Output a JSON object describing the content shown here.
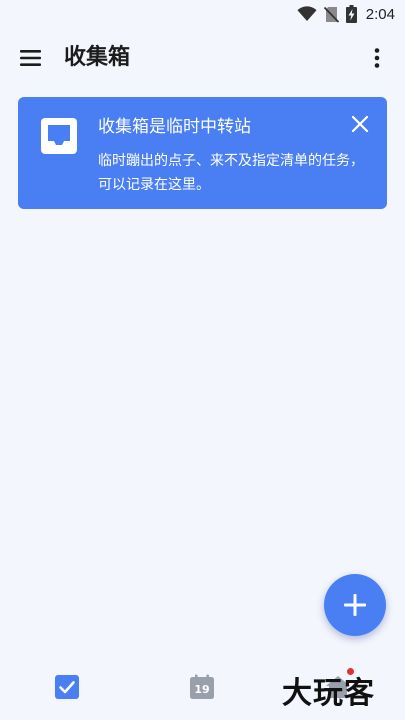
{
  "status_bar": {
    "time": "2:04",
    "icons": [
      "wifi-icon",
      "no-sim-icon",
      "battery-charging-icon"
    ]
  },
  "app_bar": {
    "title": "收集箱",
    "menu_icon": "hamburger-menu-icon",
    "more_icon": "more-vertical-icon"
  },
  "info_card": {
    "title": "收集箱是临时中转站",
    "description": "临时蹦出的点子、来不及指定清单的任务，可以记录在这里。",
    "icon": "inbox-icon",
    "close_icon": "close-icon",
    "color": "#4a7ef3"
  },
  "fab": {
    "icon": "plus-icon",
    "color": "#4a7ef3"
  },
  "bottom_nav": {
    "items": [
      {
        "icon": "checkbox-icon",
        "active": true
      },
      {
        "icon": "calendar-icon",
        "day": "19",
        "active": false
      },
      {
        "icon": "house-icon",
        "active": false
      }
    ]
  },
  "watermark": {
    "text": "大玩客"
  },
  "colors": {
    "background": "#f4f6fd",
    "accent": "#4a7ef3",
    "notification": "#e0322e"
  }
}
